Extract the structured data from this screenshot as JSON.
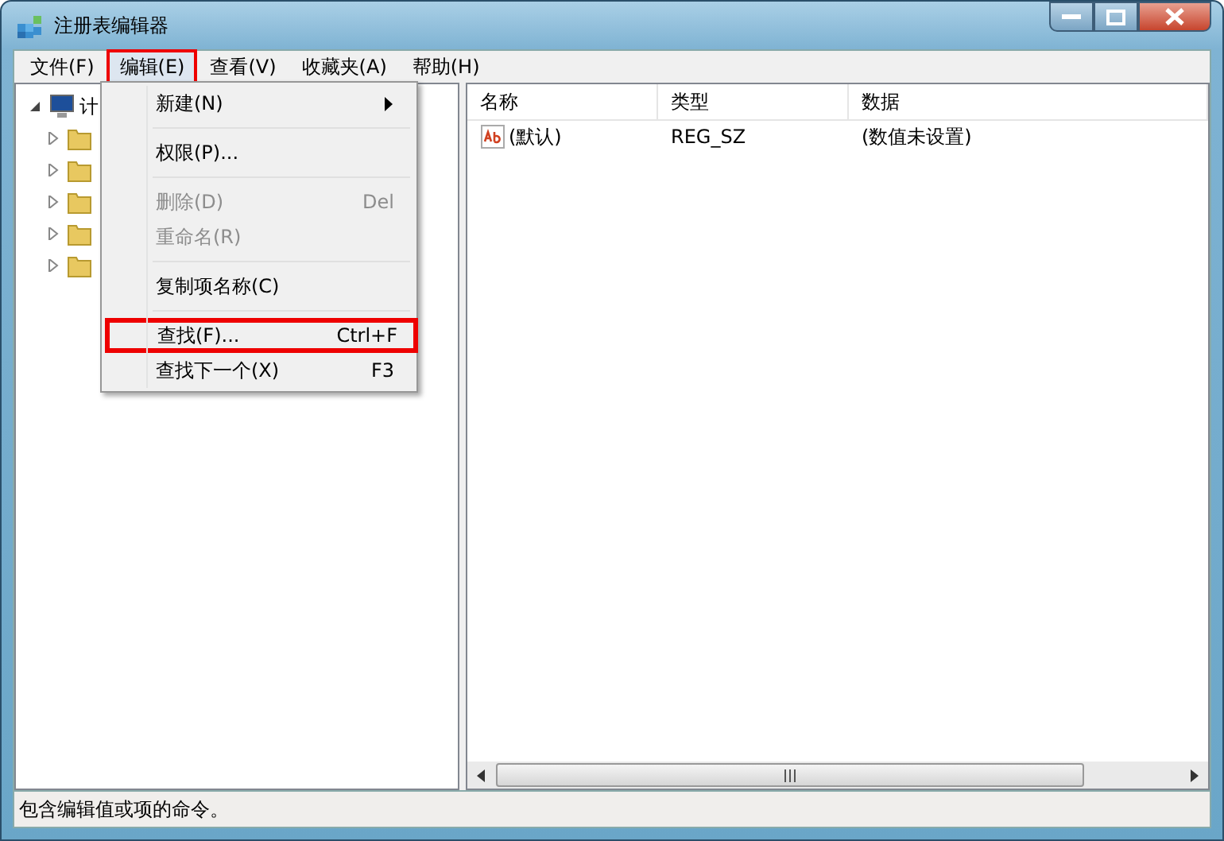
{
  "window": {
    "title": "注册表编辑器"
  },
  "menubar": [
    {
      "label": "文件(F)",
      "selected": false,
      "highlighted": false
    },
    {
      "label": "编辑(E)",
      "selected": true,
      "highlighted": true
    },
    {
      "label": "查看(V)",
      "selected": false,
      "highlighted": false
    },
    {
      "label": "收藏夹(A)",
      "selected": false,
      "highlighted": false
    },
    {
      "label": "帮助(H)",
      "selected": false,
      "highlighted": false
    }
  ],
  "tree": {
    "label": "计",
    "expanded": true,
    "children": [
      {
        "expanded": false
      },
      {
        "expanded": false
      },
      {
        "expanded": false
      },
      {
        "expanded": false
      },
      {
        "expanded": false
      }
    ]
  },
  "menu": [
    {
      "kind": "item",
      "label": "新建(N)",
      "submenu": true,
      "disabled": false,
      "highlighted": false
    },
    {
      "kind": "separator"
    },
    {
      "kind": "item",
      "label": "权限(P)...",
      "disabled": false,
      "highlighted": false
    },
    {
      "kind": "separator"
    },
    {
      "kind": "item",
      "label": "删除(D)",
      "shortcut": "Del",
      "disabled": true,
      "highlighted": false
    },
    {
      "kind": "item",
      "label": "重命名(R)",
      "disabled": true,
      "highlighted": false
    },
    {
      "kind": "separator"
    },
    {
      "kind": "item",
      "label": "复制项名称(C)",
      "disabled": false,
      "highlighted": false
    },
    {
      "kind": "separator"
    },
    {
      "kind": "item",
      "label": "查找(F)...",
      "shortcut": "Ctrl+F",
      "disabled": false,
      "highlighted": true
    },
    {
      "kind": "item",
      "label": "查找下一个(X)",
      "shortcut": "F3",
      "disabled": false,
      "highlighted": false
    }
  ],
  "table": {
    "columns": [
      "名称",
      "类型",
      "数据"
    ],
    "rows": [
      {
        "name": "(默认)",
        "type": "REG_SZ",
        "data": "(数值未设置)"
      }
    ]
  },
  "status_bar": "包含编辑值或项的命令。"
}
